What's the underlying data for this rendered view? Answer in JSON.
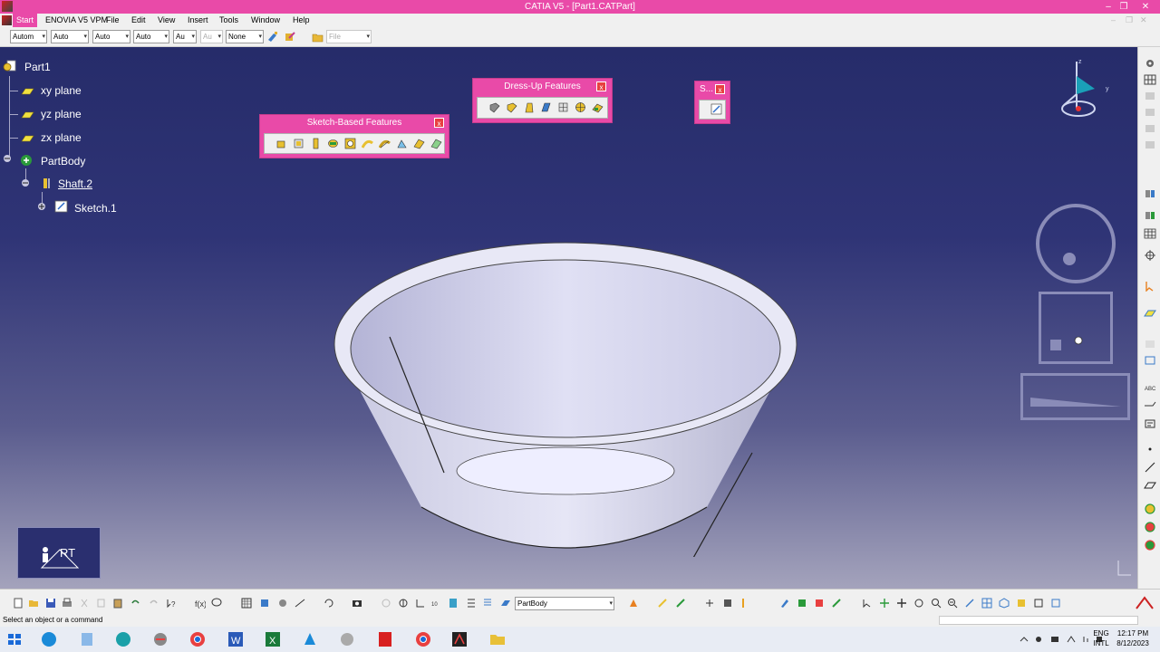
{
  "window": {
    "title": "CATIA V5 - [Part1.CATPart]",
    "controls": [
      "–",
      "❐",
      "✕"
    ],
    "mdi_controls": [
      "–",
      "❐",
      "✕"
    ]
  },
  "menu": {
    "items": [
      {
        "label": "Start"
      },
      {
        "label": "ENOVIA V5 VPM"
      },
      {
        "label": "File"
      },
      {
        "label": "Edit"
      },
      {
        "label": "View"
      },
      {
        "label": "Insert"
      },
      {
        "label": "Tools"
      },
      {
        "label": "Window"
      },
      {
        "label": "Help"
      }
    ]
  },
  "toolbar": {
    "combos": [
      {
        "value": "Autom"
      },
      {
        "value": "Auto"
      },
      {
        "value": "Auto"
      },
      {
        "value": "Auto"
      },
      {
        "value": "Au"
      },
      {
        "value": "Au"
      },
      {
        "value": "None"
      },
      {
        "value": "File"
      }
    ]
  },
  "tree": {
    "root": "Part1",
    "planes": [
      "xy plane",
      "yz plane",
      "zx plane"
    ],
    "body": "PartBody",
    "feature": "Shaft.2",
    "sketch": "Sketch.1"
  },
  "panels": {
    "sketch_based": {
      "title": "Sketch-Based Features",
      "close": "x"
    },
    "dress_up": {
      "title": "Dress-Up Features",
      "close": "x"
    },
    "small": {
      "title": "S...",
      "close": "x"
    }
  },
  "rt_box": {
    "label": "RT"
  },
  "bottom": {
    "body_select": "PartBody"
  },
  "status": {
    "message": "Select an object or a command"
  },
  "tray": {
    "lang_top": "ENG",
    "lang_bottom": "INTL",
    "time": "12:17 PM",
    "date": "8/12/2023"
  },
  "colors": {
    "accent": "#e94aa8",
    "viewport_top": "#262c6a",
    "viewport_bottom": "#a4a3bc"
  }
}
